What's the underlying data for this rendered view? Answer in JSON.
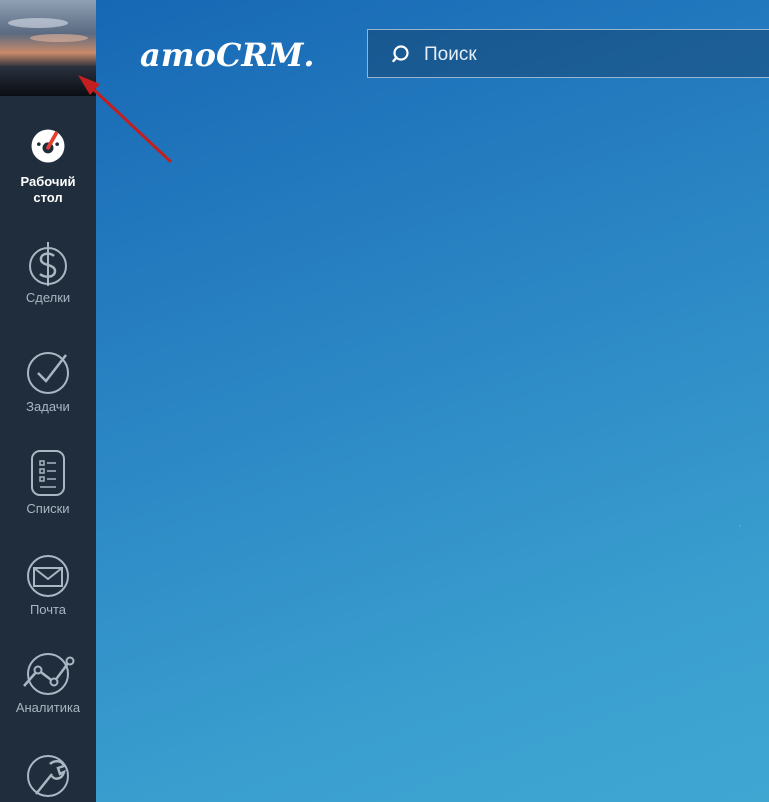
{
  "header": {
    "logo_text": "amoCRM.",
    "search_placeholder": "Поиск"
  },
  "sidebar": {
    "items": [
      {
        "label": "Рабочий стол",
        "icon": "dashboard-gauge-icon",
        "active": true
      },
      {
        "label": "Сделки",
        "icon": "dollar-icon",
        "active": false
      },
      {
        "label": "Задачи",
        "icon": "check-circle-icon",
        "active": false
      },
      {
        "label": "Списки",
        "icon": "list-icon",
        "active": false
      },
      {
        "label": "Почта",
        "icon": "mail-icon",
        "active": false
      },
      {
        "label": "Аналитика",
        "icon": "analytics-icon",
        "active": false
      },
      {
        "label": "",
        "icon": "wrench-icon",
        "active": false
      }
    ]
  },
  "colors": {
    "sidebar_bg": "#1f2d3c",
    "accent_red": "#e5402f",
    "background_top": "#1565b3",
    "background_bottom": "#3fa6d2"
  }
}
